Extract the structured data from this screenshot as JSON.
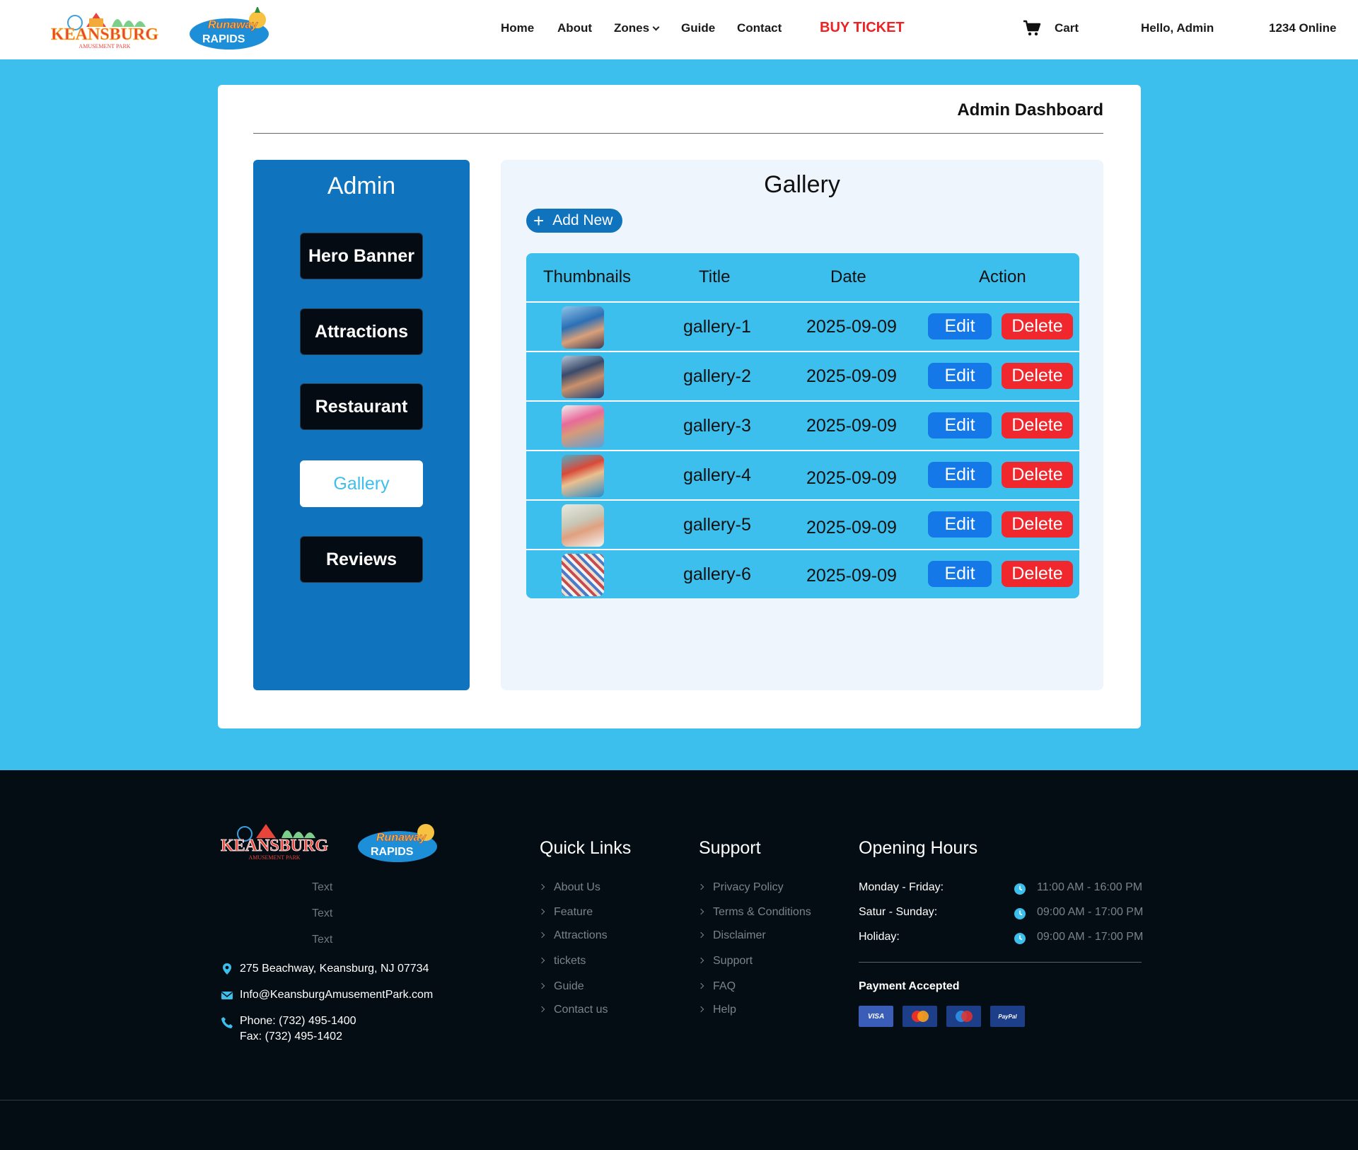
{
  "header": {
    "logo_keansburg": {
      "line1": "KEANSBURG",
      "line2": "AMUSEMENT PARK"
    },
    "logo_runaway": {
      "line1": "Runaway",
      "line2": "RAPIDS"
    },
    "nav": {
      "home": "Home",
      "about": "About",
      "zones": "Zones",
      "guide": "Guide",
      "contact": "Contact",
      "buy_ticket": "BUY TICKET",
      "cart": "Cart",
      "greeting": "Hello, Admin",
      "online": "1234 Online"
    }
  },
  "dashboard": {
    "title": "Admin Dashboard",
    "sidebar": {
      "title": "Admin",
      "items": [
        {
          "label": "Hero Banner",
          "active": false
        },
        {
          "label": "Attractions",
          "active": false
        },
        {
          "label": "Restaurant",
          "active": false
        },
        {
          "label": "Gallery",
          "active": true
        },
        {
          "label": "Reviews",
          "active": false
        }
      ]
    },
    "gallery": {
      "title": "Gallery",
      "add_label": "Add New",
      "columns": [
        "Thumbnails",
        "Title",
        "Date",
        "Action"
      ],
      "rows": [
        {
          "title": "gallery-1",
          "date": "2025-09-09"
        },
        {
          "title": "gallery-2",
          "date": "2025-09-09"
        },
        {
          "title": "gallery-3",
          "date": "2025-09-09"
        },
        {
          "title": "gallery-4",
          "date": "2025-09-09"
        },
        {
          "title": "gallery-5",
          "date": "2025-09-09"
        },
        {
          "title": "gallery-6",
          "date": "2025-09-09"
        }
      ],
      "edit_label": "Edit",
      "delete_label": "Delete"
    }
  },
  "footer": {
    "texts": [
      "Text",
      "Text",
      "Text"
    ],
    "address": "275 Beachway, Keansburg, NJ 07734",
    "email": "Info@KeansburgAmusementPark.com",
    "phone": "Phone: (732) 495-1400",
    "fax": "Fax: (732) 495-1402",
    "quick_links": {
      "heading": "Quick Links",
      "items": [
        "About Us",
        "Feature",
        "Attractions",
        "tickets",
        "Guide",
        "Contact us"
      ]
    },
    "support": {
      "heading": "Support",
      "items": [
        "Privacy Policy",
        "Terms & Conditions",
        "Disclaimer",
        "Support",
        "FAQ",
        "Help"
      ]
    },
    "hours": {
      "heading": "Opening Hours",
      "rows": [
        {
          "day": "Monday - Friday:",
          "time": "11:00 AM - 16:00 PM"
        },
        {
          "day": "Satur - Sunday:",
          "time": "09:00 AM - 17:00 PM"
        },
        {
          "day": "Holiday:",
          "time": "09:00 AM - 17:00 PM"
        }
      ]
    },
    "payment": {
      "heading": "Payment Accepted",
      "cards": [
        "VISA",
        "MasterCard",
        "Maestro",
        "PayPal"
      ]
    }
  },
  "colors": {
    "page_bg": "#3dbfee",
    "sidebar_bg": "#0f73bd",
    "edit": "#1478e8",
    "delete": "#f0282d",
    "buy_ticket": "#ee2222",
    "footer_bg": "#050d14"
  }
}
